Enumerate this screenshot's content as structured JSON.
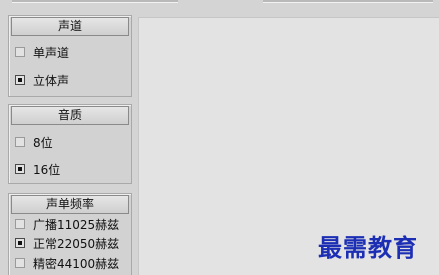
{
  "channel": {
    "title": "声道",
    "options": [
      {
        "label": "单声道",
        "checked": false
      },
      {
        "label": "立体声",
        "checked": true
      }
    ]
  },
  "quality": {
    "title": "音质",
    "options": [
      {
        "label": "8位",
        "checked": false
      },
      {
        "label": "16位",
        "checked": true
      }
    ]
  },
  "sample_rate": {
    "title": "声单频率",
    "options": [
      {
        "label": "广播11025赫兹",
        "checked": false
      },
      {
        "label": "正常22050赫兹",
        "checked": true
      },
      {
        "label": "精密44100赫兹",
        "checked": false
      }
    ]
  },
  "watermark": "最需教育"
}
